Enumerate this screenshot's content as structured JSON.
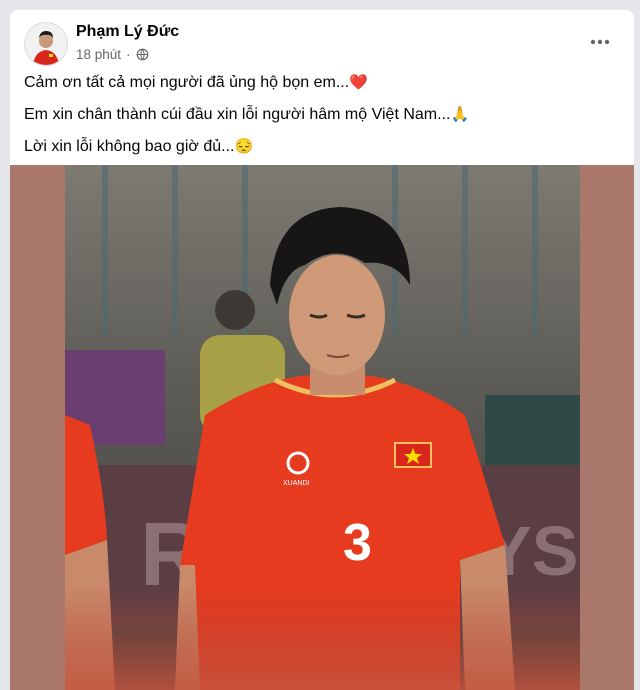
{
  "post": {
    "author": "Phạm Lý Đức",
    "time": "18 phút",
    "privacy_icon": "globe-icon",
    "more_icon": "more-horizontal-icon",
    "lines": [
      {
        "text": "Cảm ơn tất cả mọi người đã ủng hộ bọn em...",
        "emoji": "❤️"
      },
      {
        "text": "Em xin chân thành cúi đầu xin lỗi người hâm mộ Việt Nam...",
        "emoji": "🙏"
      },
      {
        "text": "Lời xin lỗi không bao giờ đủ...",
        "emoji": "😔"
      }
    ]
  },
  "photo": {
    "jersey_number": "3",
    "colors": {
      "jersey": "#e63b1f",
      "frame": "#a9786b",
      "flag": "#d9261c",
      "star": "#ffdd00"
    }
  }
}
